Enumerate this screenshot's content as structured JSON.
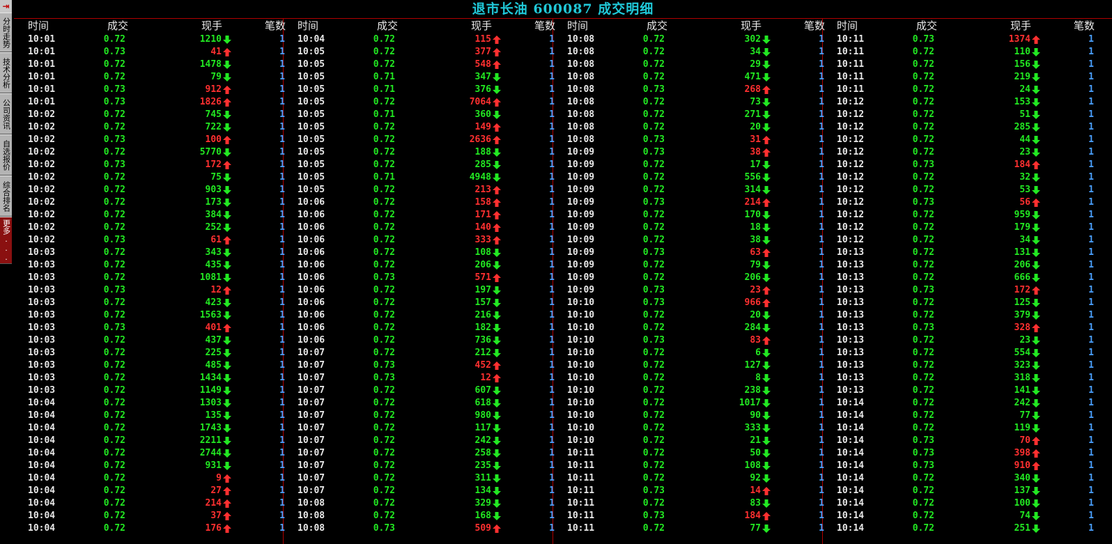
{
  "title": "退市长油 600087 成交明细",
  "sidebar": {
    "exit_icon": "exit-icon",
    "tabs": [
      "分时走势",
      "技术分析",
      "公司资讯",
      "自选报价",
      "综合排名",
      "更多..."
    ]
  },
  "headers": {
    "time": "时间",
    "price": "成交",
    "volume": "现手",
    "count": "笔数"
  },
  "colors": {
    "up": "#ff3030",
    "down": "#22e822",
    "count": "#4aa0ff",
    "title": "#20c8d8",
    "separator": "#b00000"
  },
  "panels": [
    {
      "rows": [
        [
          "10:01",
          "0.72",
          "1210",
          "down",
          "1"
        ],
        [
          "10:01",
          "0.73",
          "41",
          "up",
          "1"
        ],
        [
          "10:01",
          "0.72",
          "1478",
          "down",
          "1"
        ],
        [
          "10:01",
          "0.72",
          "79",
          "down",
          "1"
        ],
        [
          "10:01",
          "0.73",
          "912",
          "up",
          "1"
        ],
        [
          "10:01",
          "0.73",
          "1826",
          "up",
          "1"
        ],
        [
          "10:02",
          "0.72",
          "745",
          "down",
          "1"
        ],
        [
          "10:02",
          "0.72",
          "722",
          "down",
          "1"
        ],
        [
          "10:02",
          "0.73",
          "100",
          "up",
          "1"
        ],
        [
          "10:02",
          "0.72",
          "5770",
          "down",
          "1"
        ],
        [
          "10:02",
          "0.73",
          "172",
          "up",
          "1"
        ],
        [
          "10:02",
          "0.72",
          "75",
          "down",
          "1"
        ],
        [
          "10:02",
          "0.72",
          "903",
          "down",
          "1"
        ],
        [
          "10:02",
          "0.72",
          "173",
          "down",
          "1"
        ],
        [
          "10:02",
          "0.72",
          "384",
          "down",
          "1"
        ],
        [
          "10:02",
          "0.72",
          "252",
          "down",
          "1"
        ],
        [
          "10:02",
          "0.73",
          "61",
          "up",
          "1"
        ],
        [
          "10:03",
          "0.72",
          "343",
          "down",
          "1"
        ],
        [
          "10:03",
          "0.72",
          "435",
          "down",
          "1"
        ],
        [
          "10:03",
          "0.72",
          "1081",
          "down",
          "1"
        ],
        [
          "10:03",
          "0.73",
          "12",
          "up",
          "1"
        ],
        [
          "10:03",
          "0.72",
          "423",
          "down",
          "1"
        ],
        [
          "10:03",
          "0.72",
          "1563",
          "down",
          "1"
        ],
        [
          "10:03",
          "0.73",
          "401",
          "up",
          "1"
        ],
        [
          "10:03",
          "0.72",
          "437",
          "down",
          "1"
        ],
        [
          "10:03",
          "0.72",
          "225",
          "down",
          "1"
        ],
        [
          "10:03",
          "0.72",
          "485",
          "down",
          "1"
        ],
        [
          "10:03",
          "0.72",
          "1434",
          "down",
          "1"
        ],
        [
          "10:03",
          "0.72",
          "1149",
          "down",
          "1"
        ],
        [
          "10:04",
          "0.72",
          "1303",
          "down",
          "1"
        ],
        [
          "10:04",
          "0.72",
          "135",
          "down",
          "1"
        ],
        [
          "10:04",
          "0.72",
          "1743",
          "down",
          "1"
        ],
        [
          "10:04",
          "0.72",
          "2211",
          "down",
          "1"
        ],
        [
          "10:04",
          "0.72",
          "2744",
          "down",
          "1"
        ],
        [
          "10:04",
          "0.72",
          "931",
          "down",
          "1"
        ],
        [
          "10:04",
          "0.72",
          "9",
          "up",
          "1"
        ],
        [
          "10:04",
          "0.72",
          "27",
          "up",
          "1"
        ],
        [
          "10:04",
          "0.72",
          "214",
          "up",
          "1"
        ],
        [
          "10:04",
          "0.72",
          "37",
          "up",
          "1"
        ],
        [
          "10:04",
          "0.72",
          "176",
          "up",
          "1"
        ]
      ]
    },
    {
      "rows": [
        [
          "10:04",
          "0.72",
          "115",
          "up",
          "1"
        ],
        [
          "10:05",
          "0.72",
          "377",
          "up",
          "1"
        ],
        [
          "10:05",
          "0.72",
          "548",
          "up",
          "1"
        ],
        [
          "10:05",
          "0.71",
          "347",
          "down",
          "1"
        ],
        [
          "10:05",
          "0.71",
          "376",
          "down",
          "1"
        ],
        [
          "10:05",
          "0.72",
          "7064",
          "up",
          "1"
        ],
        [
          "10:05",
          "0.71",
          "360",
          "down",
          "1"
        ],
        [
          "10:05",
          "0.72",
          "149",
          "up",
          "1"
        ],
        [
          "10:05",
          "0.72",
          "2636",
          "up",
          "1"
        ],
        [
          "10:05",
          "0.72",
          "188",
          "down",
          "1"
        ],
        [
          "10:05",
          "0.72",
          "285",
          "down",
          "1"
        ],
        [
          "10:05",
          "0.71",
          "4948",
          "down",
          "1"
        ],
        [
          "10:05",
          "0.72",
          "213",
          "up",
          "1"
        ],
        [
          "10:06",
          "0.72",
          "158",
          "up",
          "1"
        ],
        [
          "10:06",
          "0.72",
          "171",
          "up",
          "1"
        ],
        [
          "10:06",
          "0.72",
          "140",
          "up",
          "1"
        ],
        [
          "10:06",
          "0.72",
          "333",
          "up",
          "1"
        ],
        [
          "10:06",
          "0.72",
          "108",
          "down",
          "1"
        ],
        [
          "10:06",
          "0.72",
          "206",
          "down",
          "1"
        ],
        [
          "10:06",
          "0.73",
          "571",
          "up",
          "1"
        ],
        [
          "10:06",
          "0.72",
          "197",
          "down",
          "1"
        ],
        [
          "10:06",
          "0.72",
          "157",
          "down",
          "1"
        ],
        [
          "10:06",
          "0.72",
          "216",
          "down",
          "1"
        ],
        [
          "10:06",
          "0.72",
          "182",
          "down",
          "1"
        ],
        [
          "10:06",
          "0.72",
          "736",
          "down",
          "1"
        ],
        [
          "10:07",
          "0.72",
          "212",
          "down",
          "1"
        ],
        [
          "10:07",
          "0.73",
          "452",
          "up",
          "1"
        ],
        [
          "10:07",
          "0.73",
          "12",
          "up",
          "1"
        ],
        [
          "10:07",
          "0.72",
          "607",
          "down",
          "1"
        ],
        [
          "10:07",
          "0.72",
          "618",
          "down",
          "1"
        ],
        [
          "10:07",
          "0.72",
          "980",
          "down",
          "1"
        ],
        [
          "10:07",
          "0.72",
          "117",
          "down",
          "1"
        ],
        [
          "10:07",
          "0.72",
          "242",
          "down",
          "1"
        ],
        [
          "10:07",
          "0.72",
          "258",
          "down",
          "1"
        ],
        [
          "10:07",
          "0.72",
          "235",
          "down",
          "1"
        ],
        [
          "10:07",
          "0.72",
          "311",
          "down",
          "1"
        ],
        [
          "10:07",
          "0.72",
          "134",
          "down",
          "1"
        ],
        [
          "10:08",
          "0.72",
          "329",
          "down",
          "1"
        ],
        [
          "10:08",
          "0.72",
          "168",
          "down",
          "1"
        ],
        [
          "10:08",
          "0.73",
          "509",
          "up",
          "1"
        ]
      ]
    },
    {
      "rows": [
        [
          "10:08",
          "0.72",
          "302",
          "down",
          "1"
        ],
        [
          "10:08",
          "0.72",
          "34",
          "down",
          "1"
        ],
        [
          "10:08",
          "0.72",
          "29",
          "down",
          "1"
        ],
        [
          "10:08",
          "0.72",
          "471",
          "down",
          "1"
        ],
        [
          "10:08",
          "0.73",
          "268",
          "up",
          "1"
        ],
        [
          "10:08",
          "0.72",
          "73",
          "down",
          "1"
        ],
        [
          "10:08",
          "0.72",
          "271",
          "down",
          "1"
        ],
        [
          "10:08",
          "0.72",
          "20",
          "down",
          "1"
        ],
        [
          "10:08",
          "0.73",
          "31",
          "up",
          "1"
        ],
        [
          "10:09",
          "0.73",
          "38",
          "up",
          "1"
        ],
        [
          "10:09",
          "0.72",
          "17",
          "down",
          "1"
        ],
        [
          "10:09",
          "0.72",
          "556",
          "down",
          "1"
        ],
        [
          "10:09",
          "0.72",
          "314",
          "down",
          "1"
        ],
        [
          "10:09",
          "0.73",
          "214",
          "up",
          "1"
        ],
        [
          "10:09",
          "0.72",
          "170",
          "down",
          "1"
        ],
        [
          "10:09",
          "0.72",
          "18",
          "down",
          "1"
        ],
        [
          "10:09",
          "0.72",
          "38",
          "down",
          "1"
        ],
        [
          "10:09",
          "0.73",
          "63",
          "up",
          "1"
        ],
        [
          "10:09",
          "0.72",
          "79",
          "down",
          "1"
        ],
        [
          "10:09",
          "0.72",
          "206",
          "down",
          "1"
        ],
        [
          "10:09",
          "0.73",
          "23",
          "up",
          "1"
        ],
        [
          "10:10",
          "0.73",
          "966",
          "up",
          "1"
        ],
        [
          "10:10",
          "0.72",
          "20",
          "down",
          "1"
        ],
        [
          "10:10",
          "0.72",
          "284",
          "down",
          "1"
        ],
        [
          "10:10",
          "0.73",
          "83",
          "up",
          "1"
        ],
        [
          "10:10",
          "0.72",
          "6",
          "down",
          "1"
        ],
        [
          "10:10",
          "0.72",
          "127",
          "down",
          "1"
        ],
        [
          "10:10",
          "0.72",
          "8",
          "down",
          "1"
        ],
        [
          "10:10",
          "0.72",
          "238",
          "down",
          "1"
        ],
        [
          "10:10",
          "0.72",
          "1017",
          "down",
          "1"
        ],
        [
          "10:10",
          "0.72",
          "90",
          "down",
          "1"
        ],
        [
          "10:10",
          "0.72",
          "333",
          "down",
          "1"
        ],
        [
          "10:10",
          "0.72",
          "21",
          "down",
          "1"
        ],
        [
          "10:11",
          "0.72",
          "50",
          "down",
          "1"
        ],
        [
          "10:11",
          "0.72",
          "108",
          "down",
          "1"
        ],
        [
          "10:11",
          "0.72",
          "92",
          "down",
          "1"
        ],
        [
          "10:11",
          "0.73",
          "14",
          "up",
          "1"
        ],
        [
          "10:11",
          "0.72",
          "83",
          "down",
          "1"
        ],
        [
          "10:11",
          "0.73",
          "184",
          "up",
          "1"
        ],
        [
          "10:11",
          "0.72",
          "77",
          "down",
          "1"
        ]
      ]
    },
    {
      "rows": [
        [
          "10:11",
          "0.73",
          "1374",
          "up",
          "1"
        ],
        [
          "10:11",
          "0.72",
          "110",
          "down",
          "1"
        ],
        [
          "10:11",
          "0.72",
          "156",
          "down",
          "1"
        ],
        [
          "10:11",
          "0.72",
          "219",
          "down",
          "1"
        ],
        [
          "10:11",
          "0.72",
          "24",
          "down",
          "1"
        ],
        [
          "10:12",
          "0.72",
          "153",
          "down",
          "1"
        ],
        [
          "10:12",
          "0.72",
          "51",
          "down",
          "1"
        ],
        [
          "10:12",
          "0.72",
          "285",
          "down",
          "1"
        ],
        [
          "10:12",
          "0.72",
          "44",
          "down",
          "1"
        ],
        [
          "10:12",
          "0.72",
          "23",
          "down",
          "1"
        ],
        [
          "10:12",
          "0.73",
          "184",
          "up",
          "1"
        ],
        [
          "10:12",
          "0.72",
          "32",
          "down",
          "1"
        ],
        [
          "10:12",
          "0.72",
          "53",
          "down",
          "1"
        ],
        [
          "10:12",
          "0.73",
          "56",
          "up",
          "1"
        ],
        [
          "10:12",
          "0.72",
          "959",
          "down",
          "1"
        ],
        [
          "10:12",
          "0.72",
          "179",
          "down",
          "1"
        ],
        [
          "10:12",
          "0.72",
          "34",
          "down",
          "1"
        ],
        [
          "10:13",
          "0.72",
          "131",
          "down",
          "1"
        ],
        [
          "10:13",
          "0.72",
          "206",
          "down",
          "1"
        ],
        [
          "10:13",
          "0.72",
          "666",
          "down",
          "1"
        ],
        [
          "10:13",
          "0.73",
          "172",
          "up",
          "1"
        ],
        [
          "10:13",
          "0.72",
          "125",
          "down",
          "1"
        ],
        [
          "10:13",
          "0.72",
          "379",
          "down",
          "1"
        ],
        [
          "10:13",
          "0.73",
          "328",
          "up",
          "1"
        ],
        [
          "10:13",
          "0.72",
          "23",
          "down",
          "1"
        ],
        [
          "10:13",
          "0.72",
          "554",
          "down",
          "1"
        ],
        [
          "10:13",
          "0.72",
          "323",
          "down",
          "1"
        ],
        [
          "10:13",
          "0.72",
          "318",
          "down",
          "1"
        ],
        [
          "10:13",
          "0.72",
          "141",
          "down",
          "1"
        ],
        [
          "10:14",
          "0.72",
          "242",
          "down",
          "1"
        ],
        [
          "10:14",
          "0.72",
          "77",
          "down",
          "1"
        ],
        [
          "10:14",
          "0.72",
          "119",
          "down",
          "1"
        ],
        [
          "10:14",
          "0.73",
          "70",
          "up",
          "1"
        ],
        [
          "10:14",
          "0.73",
          "398",
          "up",
          "1"
        ],
        [
          "10:14",
          "0.73",
          "910",
          "up",
          "1"
        ],
        [
          "10:14",
          "0.72",
          "340",
          "down",
          "1"
        ],
        [
          "10:14",
          "0.72",
          "137",
          "down",
          "1"
        ],
        [
          "10:14",
          "0.72",
          "100",
          "down",
          "1"
        ],
        [
          "10:14",
          "0.72",
          "74",
          "down",
          "1"
        ],
        [
          "10:14",
          "0.72",
          "251",
          "down",
          "1"
        ]
      ]
    }
  ]
}
